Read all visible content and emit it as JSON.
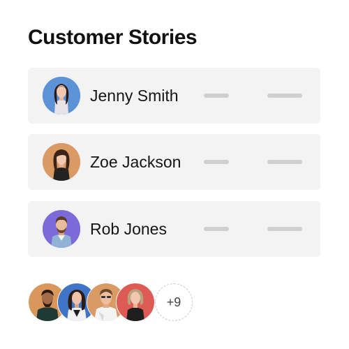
{
  "page": {
    "title": "Customer Stories"
  },
  "stories": [
    {
      "name": "Jenny Smith",
      "avatar_bg": "#5b93d6",
      "icon": "woman-avatar-icon"
    },
    {
      "name": "Zoe Jackson",
      "avatar_bg": "#d99a63",
      "icon": "woman-avatar-icon"
    },
    {
      "name": "Rob Jones",
      "avatar_bg": "#7b6ad8",
      "icon": "man-avatar-icon"
    }
  ],
  "avatar_stack": {
    "avatars": [
      {
        "bg": "#d9975b",
        "icon": "man-avatar-icon"
      },
      {
        "bg": "#3f74c6",
        "icon": "woman-avatar-icon"
      },
      {
        "bg": "#d99a63",
        "icon": "man-avatar-icon"
      },
      {
        "bg": "#de5b55",
        "icon": "woman-avatar-icon"
      }
    ],
    "more_label": "+9"
  },
  "colors": {
    "card_bg": "#f3f3f3",
    "placeholder_bar": "#cfcfcf",
    "title_text": "#111111"
  }
}
